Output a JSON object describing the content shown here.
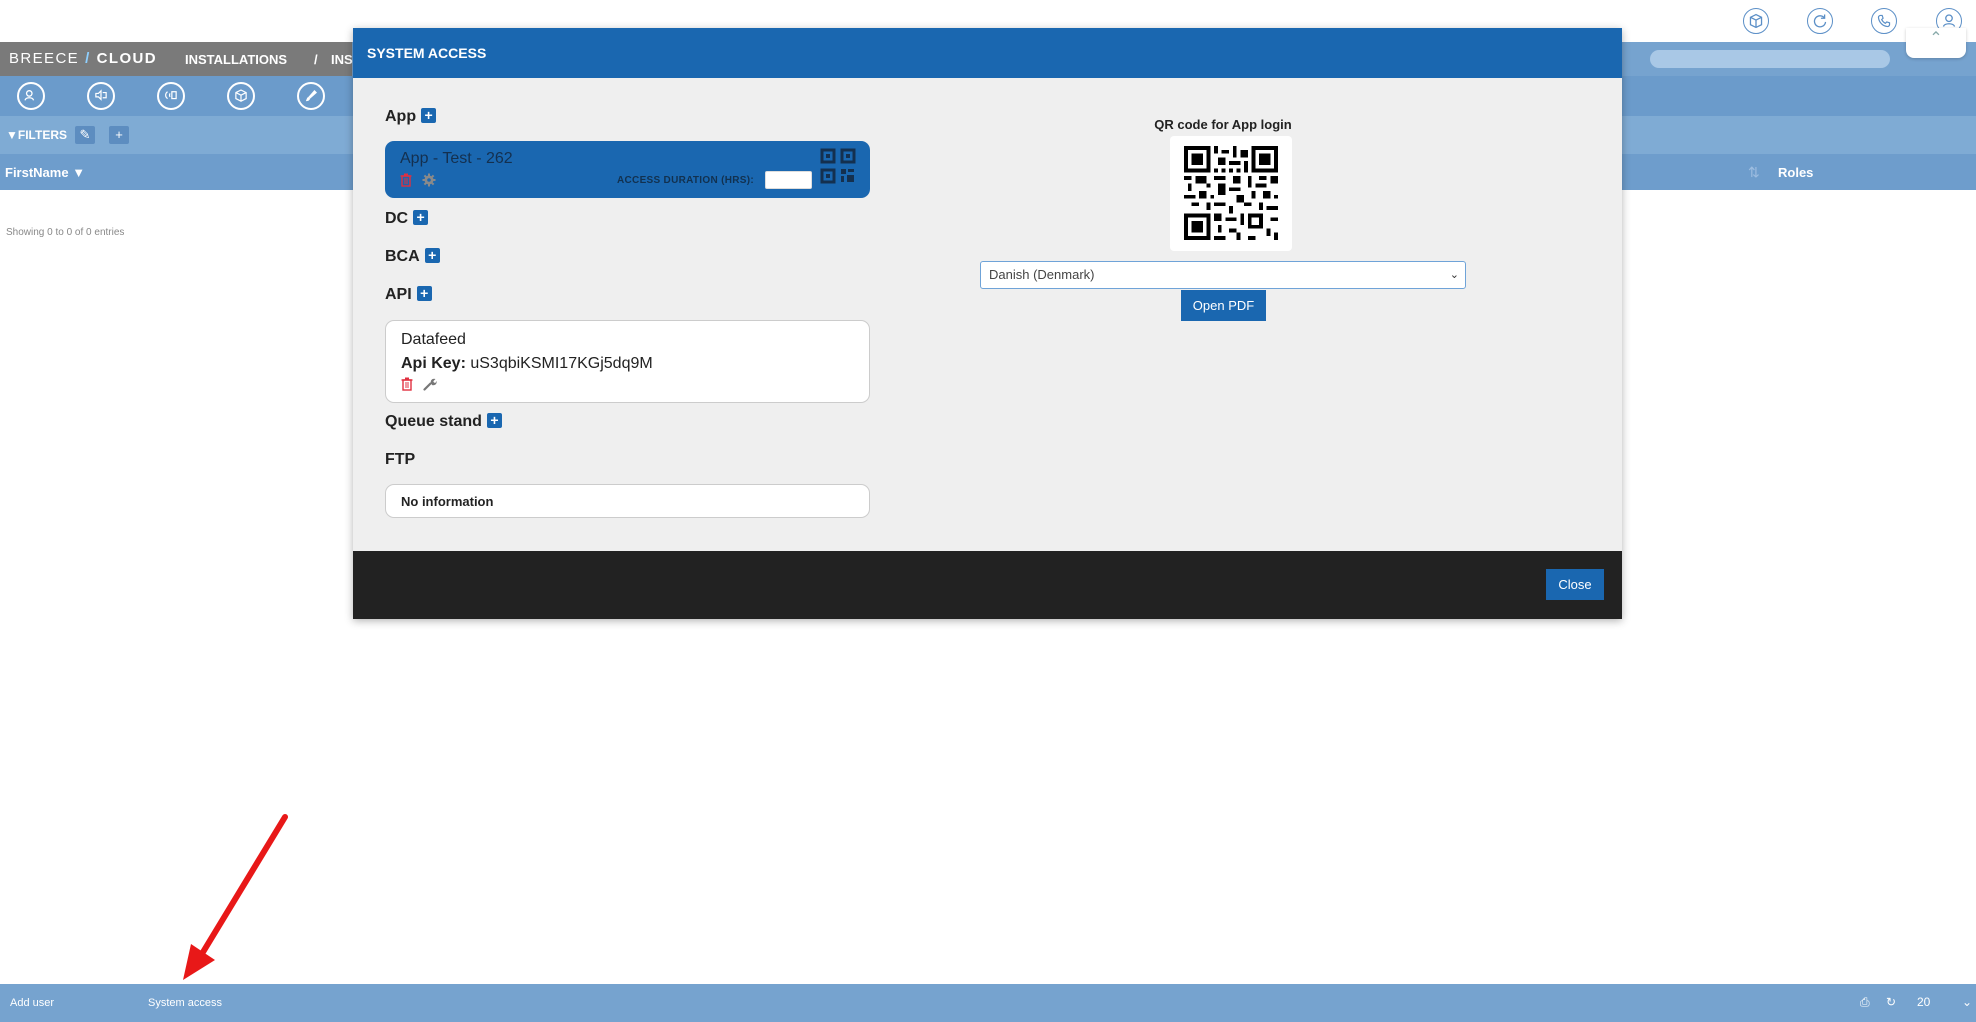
{
  "header_icons": [
    "box-icon",
    "refresh-icon",
    "phone-icon",
    "user-icon"
  ],
  "nav": {
    "brand_left": "BREECE",
    "brand_slash": "/",
    "brand_right": "CLOUD",
    "installations": "INSTALLATIONS",
    "separator": "/",
    "current": "INS"
  },
  "filters": {
    "label": "FILTERS"
  },
  "table": {
    "columns": [
      "FirstName",
      "Roles"
    ],
    "entries_info": "Showing 0 to 0 of 0 entries"
  },
  "bottom": {
    "add_user": "Add user",
    "system_access": "System access",
    "page_size": "20"
  },
  "modal": {
    "title": "SYSTEM ACCESS",
    "sections": {
      "app": "App",
      "dc": "DC",
      "bca": "BCA",
      "api": "API",
      "queue_stand": "Queue stand",
      "ftp": "FTP"
    },
    "app_card": {
      "name": "App - Test - 262",
      "access_duration_label": "ACCESS DURATION (HRS):",
      "access_duration_value": ""
    },
    "api_card": {
      "name": "Datafeed",
      "key_label": "Api Key:",
      "key_value": "uS3qbiKSMI17KGj5dq9M"
    },
    "ftp_card": {
      "text": "No information"
    },
    "qr": {
      "title": "QR code for App login",
      "language_selected": "Danish (Denmark)",
      "open_pdf": "Open PDF"
    },
    "close": "Close"
  },
  "colors": {
    "primary": "#1a67b0",
    "nav_bar": "#76a3cf",
    "footer": "#222222",
    "arrow": "#e81818",
    "delete_icon": "#e03040"
  }
}
